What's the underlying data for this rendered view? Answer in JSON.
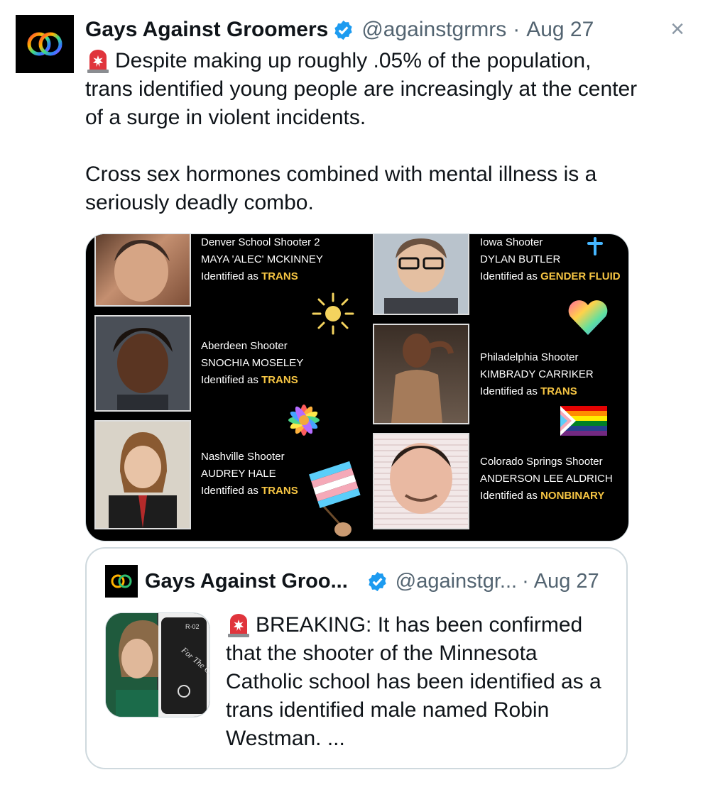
{
  "tweet": {
    "author_name": "Gays Against Groomers",
    "handle": "@againstgrmrs",
    "separator": "·",
    "date": "Aug 27",
    "close_glyph": "×",
    "text": "Despite making up roughly .05% of the population, trans identified young people are increasingly at the center of a surge in violent incidents.\n\nCross sex hormones combined with mental illness is a seriously deadly combo.",
    "verified_color": "#1d9bf0"
  },
  "media": {
    "captions": [
      {
        "title": "Denver School Shooter 2",
        "name": "MAYA 'ALEC' MCKINNEY",
        "prefix": "Identified as ",
        "label": "TRANS"
      },
      {
        "title": "Aberdeen Shooter",
        "name": "SNOCHIA MOSELEY",
        "prefix": "Identified as ",
        "label": "TRANS"
      },
      {
        "title": "Nashville Shooter",
        "name": "AUDREY HALE",
        "prefix": "Identified as ",
        "label": "TRANS"
      },
      {
        "title": "Iowa Shooter",
        "name": "DYLAN BUTLER",
        "prefix": "Identified as ",
        "label": "GENDER FLUID"
      },
      {
        "title": "Philadelphia Shooter",
        "name": "KIMBRADY CARRIKER",
        "prefix": "Identified as ",
        "label": "TRANS"
      },
      {
        "title": "Colorado Springs Shooter",
        "name": "ANDERSON LEE ALDRICH",
        "prefix": "Identified as ",
        "label": "NONBINARY"
      }
    ],
    "highlight_color": "#f6c543"
  },
  "quote": {
    "author_name": "Gays Against Groo...",
    "handle": "@againstgr...",
    "separator": "·",
    "date": "Aug 27",
    "text": "BREAKING: It has been confirmed that the shooter of the Minnesota Catholic school has been identified as a trans identified male named Robin Westman. ...",
    "thumb_text": "For The Children",
    "thumb_code": "R-02"
  }
}
